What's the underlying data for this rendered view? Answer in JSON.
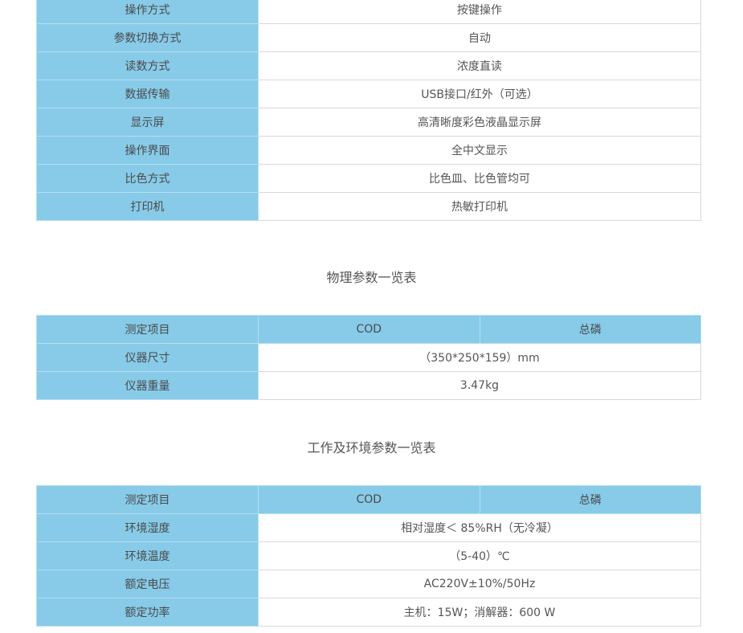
{
  "ops_table": {
    "rows": [
      {
        "label": "操作方式",
        "value": "按键操作"
      },
      {
        "label": "参数切换方式",
        "value": "自动"
      },
      {
        "label": "读数方式",
        "value": "浓度直读"
      },
      {
        "label": "数据传输",
        "value": "USB接口/红外（可选）"
      },
      {
        "label": "显示屏",
        "value": "高清晰度彩色液晶显示屏"
      },
      {
        "label": "操作界面",
        "value": "全中文显示"
      },
      {
        "label": "比色方式",
        "value": "比色皿、比色管均可"
      },
      {
        "label": "打印机",
        "value": "热敏打印机"
      }
    ]
  },
  "physical": {
    "title": "物理参数一览表",
    "header": {
      "label": "测定项目",
      "col1": "COD",
      "col2": "总磷"
    },
    "rows": [
      {
        "label": "仪器尺寸",
        "value": "（350*250*159）mm"
      },
      {
        "label": "仪器重量",
        "value": "3.47kg"
      }
    ]
  },
  "environment": {
    "title": "工作及环境参数一览表",
    "header": {
      "label": "测定项目",
      "col1": "COD",
      "col2": "总磷"
    },
    "rows": [
      {
        "label": "环境湿度",
        "value": "相对湿度＜ 85%RH（无冷凝）"
      },
      {
        "label": "环境温度",
        "value": "（5-40）℃"
      },
      {
        "label": "额定电压",
        "value": "AC220V±10%/50Hz"
      },
      {
        "label": "额定功率",
        "value": "主机：15W；消解器：600 W"
      }
    ]
  }
}
